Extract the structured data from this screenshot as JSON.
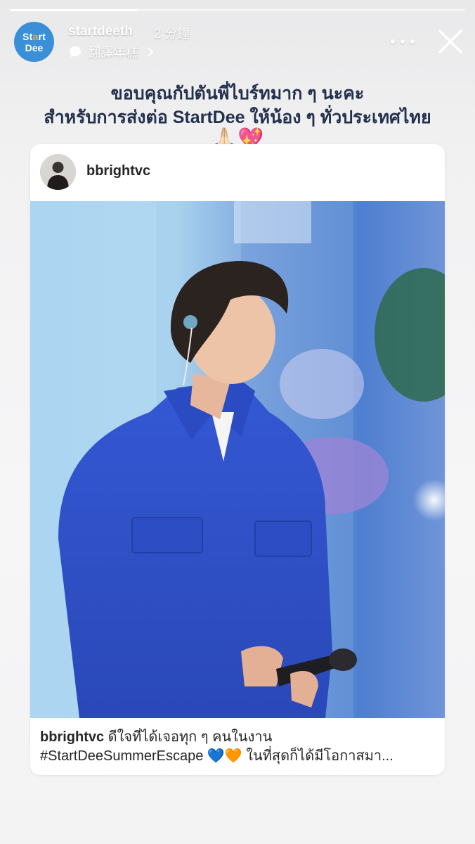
{
  "story": {
    "progress": 0.28,
    "account": {
      "avatar_line1_a": "St",
      "avatar_line1_dot": "a",
      "avatar_line1_b": "rt",
      "avatar_line2": "Dee",
      "username": "startdeeth",
      "time": "2 分鐘"
    },
    "translate_label": "翻譯年糕",
    "caption_line1": "ขอบคุณกัปตันพี่ไบร์ทมาก ๆ นะคะ",
    "caption_line2": "สำหรับการส่งต่อ StartDee ให้น้อง ๆ ทั่วประเทศไทย",
    "caption_emoji": "🙏🏻💖"
  },
  "post": {
    "username": "bbrightvc",
    "caption_user": "bbrightvc",
    "caption_text_1": " ดีใจที่ได้เจอทุก ๆ คนในงาน",
    "caption_text_2": "#StartDeeSummerEscape 💙🧡  ในที่สุดก็ได้มีโอกาสมา..."
  },
  "colors": {
    "avatar_bg": "#3a8fd6",
    "caption_text": "#23304e",
    "jacket": "#2f53c9"
  }
}
